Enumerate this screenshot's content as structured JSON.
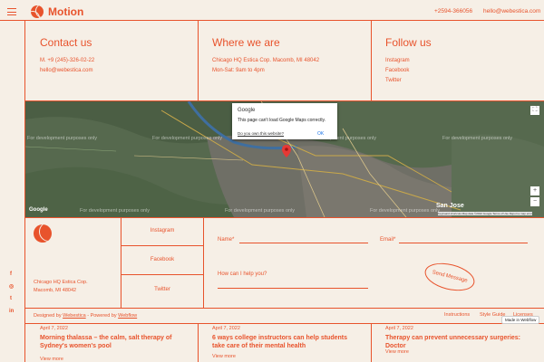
{
  "header": {
    "brand": "Motion",
    "phone": "+2594-366056",
    "email": "hello@webestica.com"
  },
  "contact": {
    "title": "Contact us",
    "phone": "M. +9 (245)-326-02-22",
    "email": "hello@webestica.com"
  },
  "where": {
    "title": "Where we are",
    "address": "Chicago HQ Estica Cop. Macomb, MI 48042",
    "hours": "Mon-Sat: 9am to 4pm"
  },
  "follow": {
    "title": "Follow us",
    "links": [
      "Instagram",
      "Facebook",
      "Twitter"
    ]
  },
  "map": {
    "dev_text": "For development purposes only",
    "dialog_brand": "Google",
    "dialog_message": "This page can't load Google Maps correctly.",
    "dialog_link": "Do you own this website?",
    "dialog_ok": "OK",
    "city_label": "San Jose",
    "footer_text": "Keyboard shortcuts  Map data ©2022 Google  Terms of Use  Report a map error",
    "google_logo": "Google",
    "zoom_in": "+",
    "zoom_out": "−",
    "fullscreen": "⛶"
  },
  "footer": {
    "address_line1": "Chicago HQ Estica Cop.",
    "address_line2": "Macomb, MI 48042",
    "socials": [
      "Instagram",
      "Facebook",
      "Twitter"
    ],
    "form": {
      "name_label": "Name*",
      "email_label": "Email*",
      "message_label": "How can I help you?",
      "send_label": "Send Message"
    },
    "designed_by_prefix": "Designed by",
    "designer": "Webestica",
    "powered_prefix": "- Powered by",
    "powered": "Webflow",
    "links": [
      "Instructions",
      "Style Guide",
      "Licenses"
    ],
    "webflow_badge": "Made in Webflow",
    "side_icons": [
      "f",
      "◎",
      "t",
      "in"
    ]
  },
  "blog": [
    {
      "date": "April 7, 2022",
      "title": "Morning thalassa – the calm, salt therapy of Sydney's women's pool",
      "more": "View more"
    },
    {
      "date": "April 7, 2022",
      "title": "6 ways college instructors can help students take care of their mental health",
      "more": "View more"
    },
    {
      "date": "April 7, 2022",
      "title": "Therapy can prevent unnecessary surgeries: Doctor",
      "more": "View more"
    }
  ],
  "colors": {
    "accent": "#e8532c",
    "background": "#f6efe6"
  }
}
